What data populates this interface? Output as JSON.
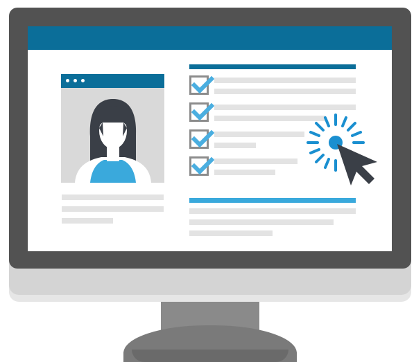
{
  "illustration": {
    "subject": "computer-monitor",
    "icons": [
      "monitor-icon",
      "profile-card-icon",
      "checkbox-checked-icon",
      "mouse-pointer-icon",
      "click-burst-icon"
    ],
    "colors": {
      "header_blue": "#0b6e99",
      "accent_blue": "#3aa9dc",
      "check_blue": "#4aaee0",
      "bezel": "#525252",
      "placeholder_line": "#e3e3e3",
      "cursor": "#3a3f47"
    },
    "checklist_count": 4,
    "checked_count": 4
  }
}
